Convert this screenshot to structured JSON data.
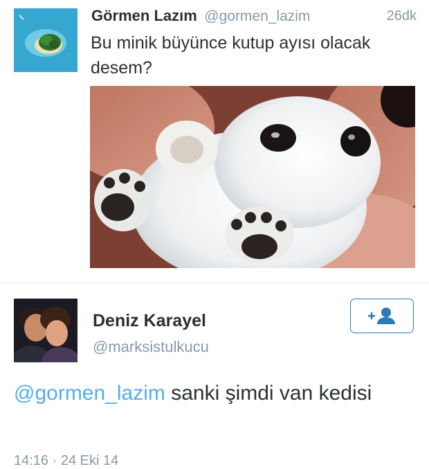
{
  "tweet1": {
    "display_name": "Görmen Lazım",
    "handle": "@gormen_lazim",
    "time": "26dk",
    "text": "Bu minik büyünce kutup ayısı olacak desem?"
  },
  "tweet2": {
    "display_name": "Deniz Karayel",
    "handle": "@marksistulkucu",
    "mention": "@gormen_lazim",
    "text": " sanki şimdi van kedisi",
    "timestamp": "14:16 · 24 Eki 14",
    "follow_icon": "add-user-icon"
  },
  "colors": {
    "text": "#292f33",
    "muted": "#8899a6",
    "link": "#55acee",
    "follow_border": "#2b7bb9"
  }
}
